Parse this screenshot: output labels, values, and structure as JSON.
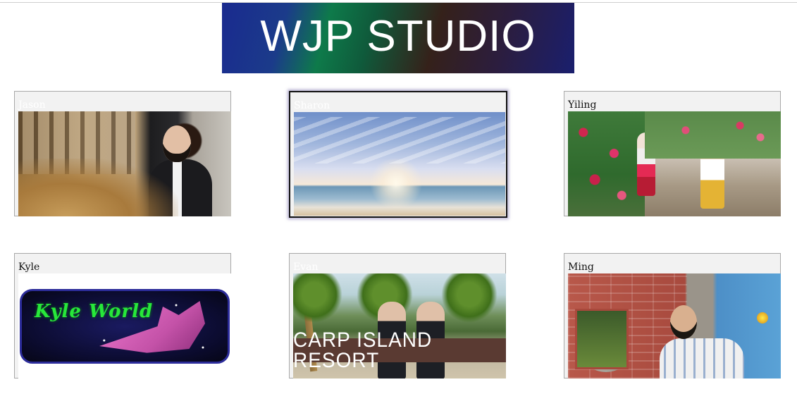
{
  "banner": {
    "title": "WJP STUDIO"
  },
  "cards": [
    {
      "name": "Jason",
      "selected": false
    },
    {
      "name": "Sharon",
      "selected": true
    },
    {
      "name": "Yiling",
      "selected": false
    },
    {
      "name": "Kyle",
      "selected": false,
      "image_text": "Kyle World"
    },
    {
      "name": "Evan",
      "selected": false,
      "image_text": "CARP ISLAND RESORT"
    },
    {
      "name": "Ming",
      "selected": false
    }
  ]
}
